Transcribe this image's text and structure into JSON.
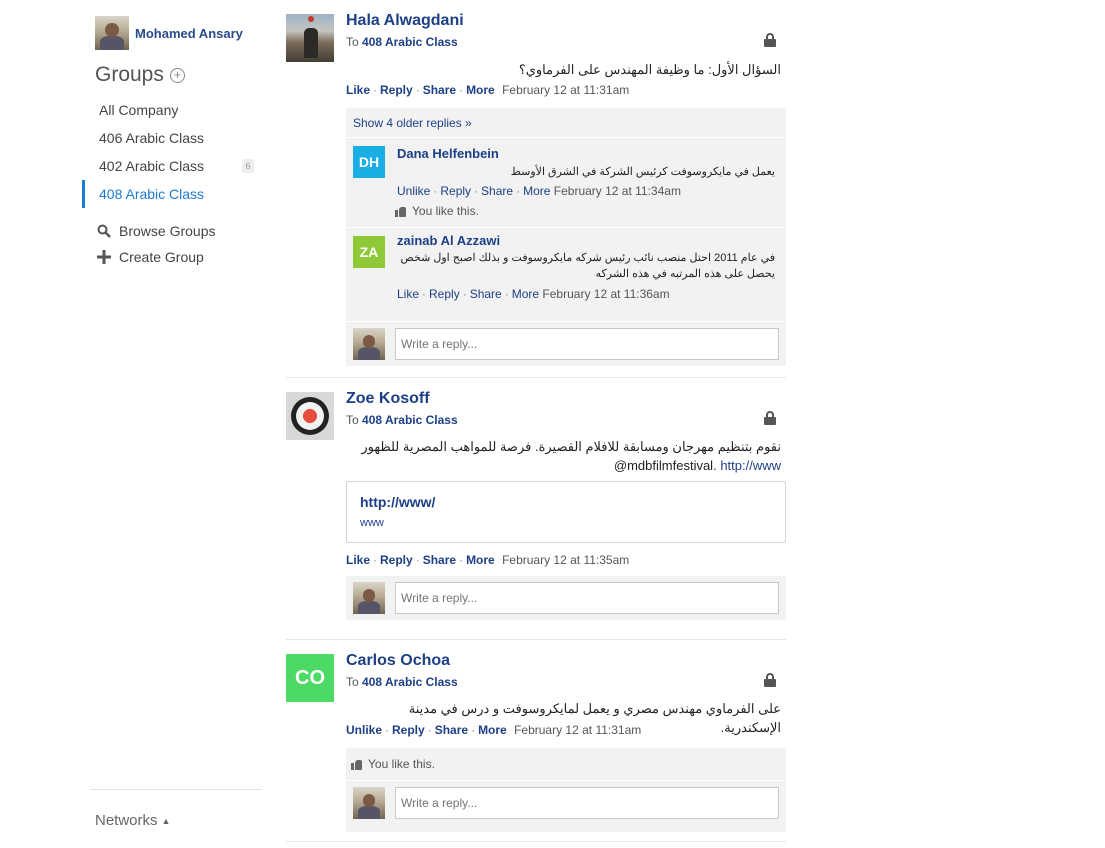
{
  "sidebar": {
    "user_name": "Mohamed Ansary",
    "groups_heading": "Groups",
    "groups": [
      {
        "label": "All Company"
      },
      {
        "label": "406 Arabic Class"
      },
      {
        "label": "402 Arabic Class",
        "badge": "6"
      },
      {
        "label": "408 Arabic Class",
        "active": true
      }
    ],
    "browse_groups": "Browse Groups",
    "create_group": "Create Group",
    "networks": "Networks"
  },
  "threads": [
    {
      "author": "Hala Alwagdani",
      "to_prefix": "To",
      "to_group": "408 Arabic Class",
      "message": "السؤال الأول: ما وظيفة المهندس على الفرماوي؟",
      "actions": [
        "Like",
        "Reply",
        "Share",
        "More"
      ],
      "timestamp": "February 12 at 11:31am",
      "show_older": "Show 4 older replies »",
      "replies": [
        {
          "initials": "DH",
          "color": "#1aaee5",
          "name": "Dana Helfenbein",
          "message": "يعمل في مايكروسوفت كرئيس الشركة في الشرق الأوسط",
          "actions": [
            "Unlike",
            "Reply",
            "Share",
            "More"
          ],
          "timestamp": "February 12 at 11:34am",
          "likes": "You like this."
        },
        {
          "initials": "ZA",
          "color": "#8fc93a",
          "name": "zainab Al Azzawi",
          "message_line1": "في عام 2011 احتل منصب نائب رئيس شركه مايكروسوفت و بذلك اصبح اول شخص",
          "message_line2": "يحصل على هذه المرتبه في هذه الشركه",
          "actions": [
            "Like",
            "Reply",
            "Share",
            "More"
          ],
          "timestamp": "February 12 at 11:36am"
        }
      ],
      "reply_placeholder": "Write a reply..."
    },
    {
      "author": "Zoe Kosoff",
      "to_prefix": "To",
      "to_group": "408 Arabic Class",
      "message_line1": "نقوم بتنظيم مهرجان ومسابقة للافلام القصيرة. فرصة للمواهب المصرية للظهور",
      "message_line2_link": "http://www",
      "message_line2_text": "@mdbfilmfestival.",
      "card_title": "http://www/",
      "card_host": "www",
      "actions": [
        "Like",
        "Reply",
        "Share",
        "More"
      ],
      "timestamp": "February 12 at 11:35am",
      "reply_placeholder": "Write a reply..."
    },
    {
      "author": "Carlos Ochoa",
      "initials": "CO",
      "color": "#4cd964",
      "to_prefix": "To",
      "to_group": "408 Arabic Class",
      "message": "على الفرماوي مهندس مصري و يعمل لمايكروسوفت و درس في مدينة الإسكندرية.",
      "actions": [
        "Unlike",
        "Reply",
        "Share",
        "More"
      ],
      "timestamp": "February 12 at 11:31am",
      "likes": "You like this.",
      "reply_placeholder": "Write a reply..."
    }
  ]
}
